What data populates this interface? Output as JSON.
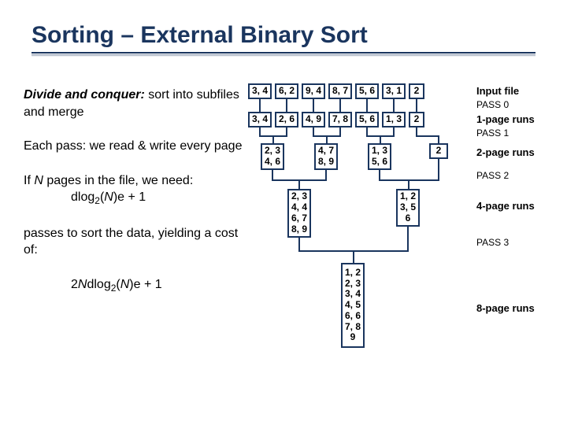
{
  "title": "Sorting – External Binary Sort",
  "text": {
    "p1a": "Divide and conquer:",
    "p1b": " sort into subfiles and merge",
    "p2": "Each pass: we read & write every page",
    "p3a": "If ",
    "p3b": "N",
    "p3c": " pages in the file, we need:",
    "p3f": "dlog",
    "p3f2": "2",
    "p3f3": "(",
    "p3f4": "N",
    "p3f5": ")e + 1",
    "p4": "passes to sort the data, yielding a cost of:",
    "p5a": "2",
    "p5b": "N",
    "p5c": "dlog",
    "p5d": "2",
    "p5e": "(",
    "p5f": "N",
    "p5g": ")e + 1"
  },
  "labels": {
    "input": "Input file",
    "pass0": "PASS 0",
    "runs1": "1-page runs",
    "pass1": "PASS 1",
    "runs2": "2-page runs",
    "pass2": "PASS 2",
    "runs4": "4-page runs",
    "pass3": "PASS 3",
    "runs8": "8-page runs"
  },
  "rows": {
    "r0": [
      "3, 4",
      "6, 2",
      "9, 4",
      "8, 7",
      "5, 6",
      "3, 1",
      "2"
    ],
    "r1": [
      "3, 4",
      "2, 6",
      "4, 9",
      "7, 8",
      "5, 6",
      "1, 3",
      "2"
    ],
    "r2": [
      [
        "2, 3",
        "4, 6"
      ],
      [
        "4, 7",
        "8, 9"
      ],
      [
        "1, 3",
        "5, 6"
      ],
      [
        "2"
      ]
    ],
    "r3": [
      [
        "2, 3",
        "4, 4",
        "6, 7",
        "8, 9"
      ],
      [
        "1, 2",
        "3, 5",
        "6"
      ]
    ],
    "r4": [
      [
        "1, 2",
        "2, 3",
        "3, 4",
        "4, 5",
        "6, 6",
        "7, 8",
        "9"
      ]
    ]
  }
}
